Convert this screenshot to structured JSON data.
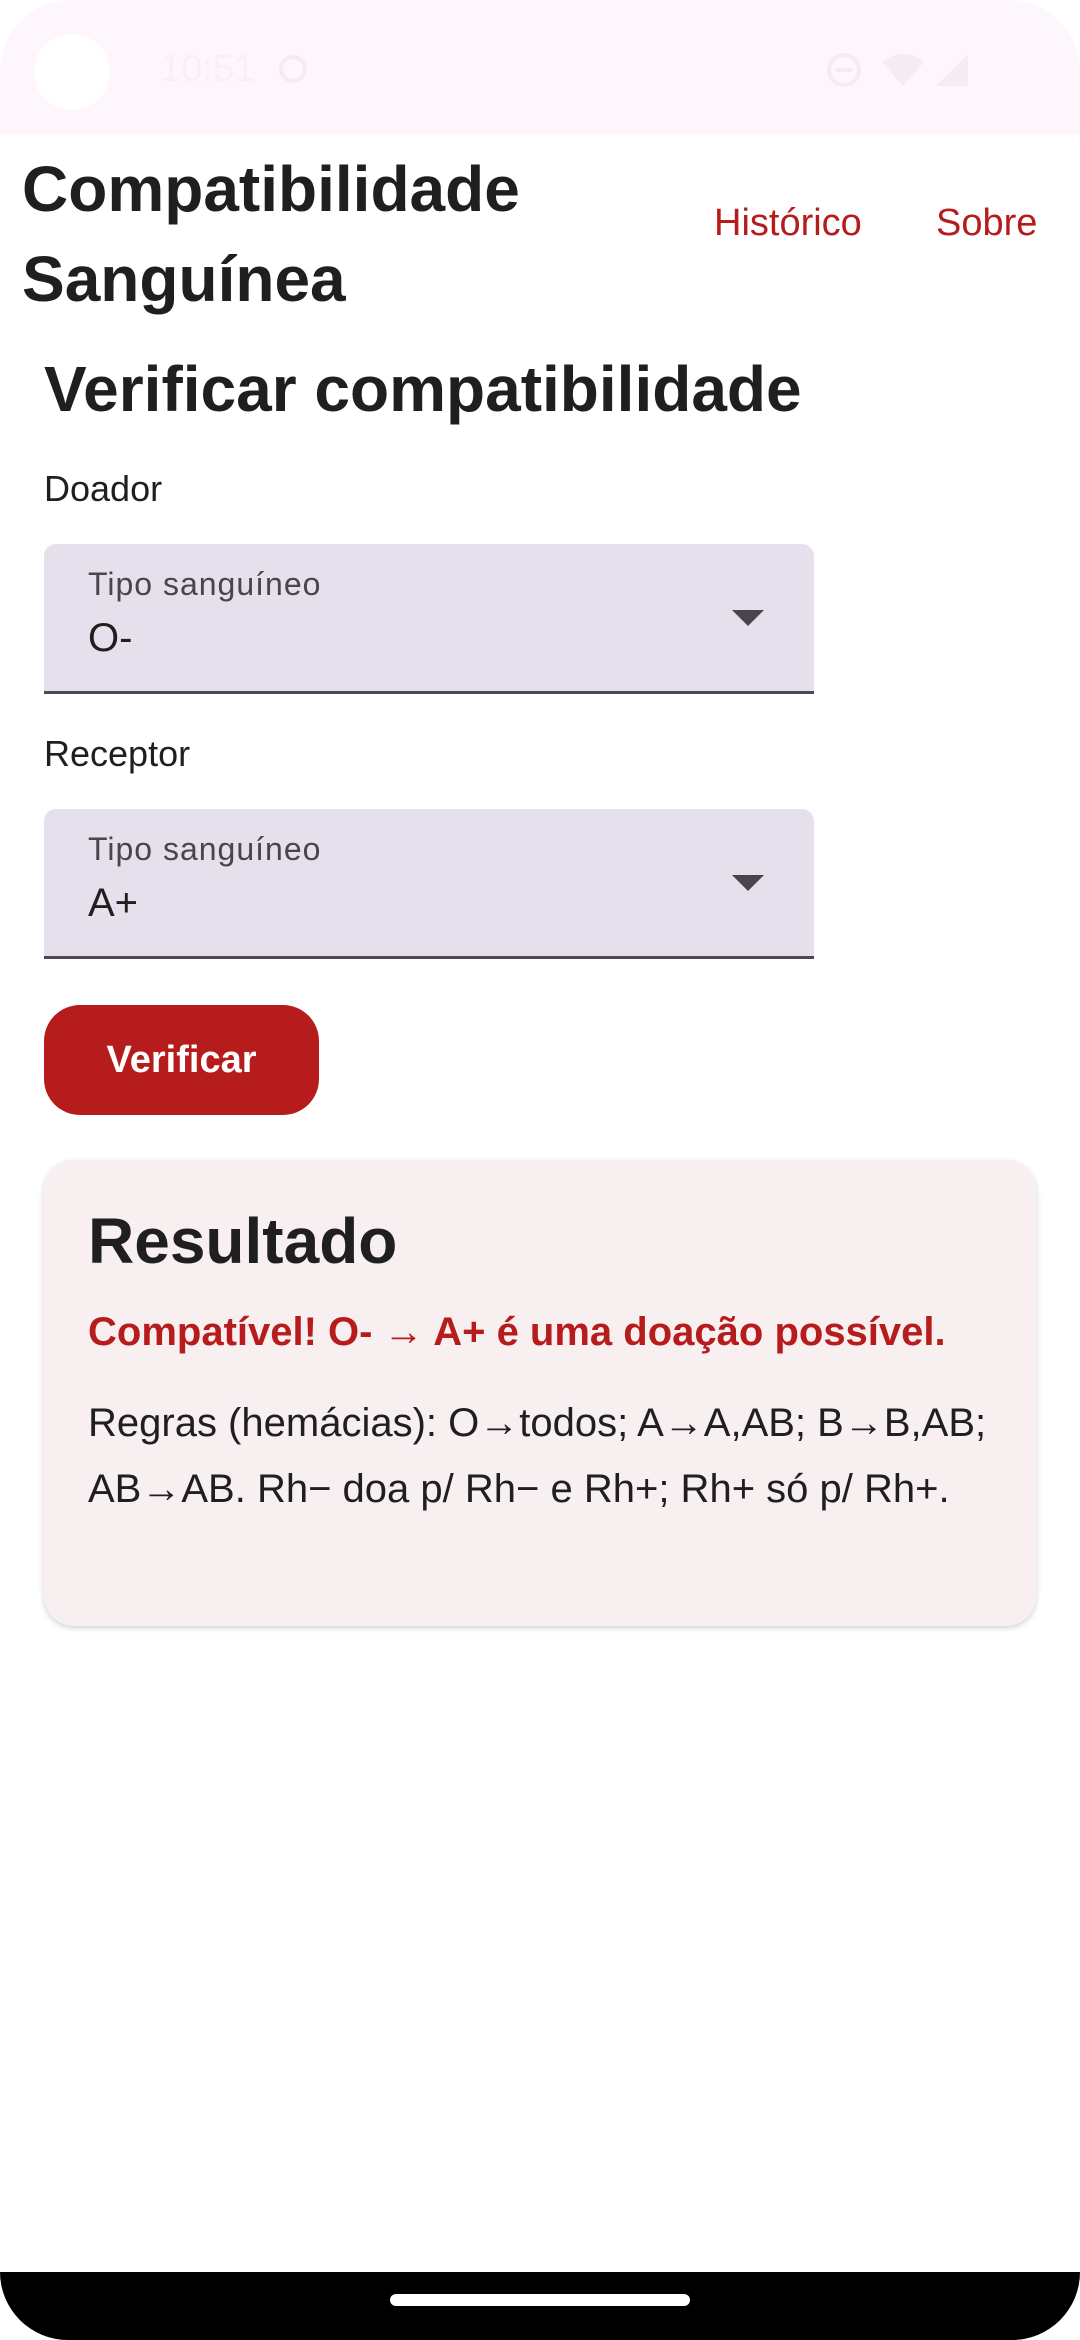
{
  "status_bar": {
    "time": "10:51",
    "icons": [
      "camera-cutout",
      "sync-icon",
      "dnd-icon",
      "wifi-icon",
      "signal-icon"
    ]
  },
  "app_bar": {
    "title": "Compatibilidade Sanguínea",
    "links": [
      {
        "label": "Histórico"
      },
      {
        "label": "Sobre"
      }
    ]
  },
  "form": {
    "heading": "Verificar compatibilidade",
    "donor": {
      "label": "Doador",
      "select_label": "Tipo sanguíneo",
      "value": "O-"
    },
    "receiver": {
      "label": "Receptor",
      "select_label": "Tipo sanguíneo",
      "value": "A+"
    },
    "submit_label": "Verificar"
  },
  "result": {
    "title": "Resultado",
    "message": "Compatível! O- → A+ é uma doação possível.",
    "rules": "Regras (hemácias): O→todos; A→A,AB; B→B,AB; AB→AB. Rh− doa p/ Rh− e Rh+; Rh+ só p/ Rh+."
  },
  "colors": {
    "accent": "#b71c1c",
    "select_bg": "#e6dfec",
    "card_bg": "#f8f0f0"
  }
}
